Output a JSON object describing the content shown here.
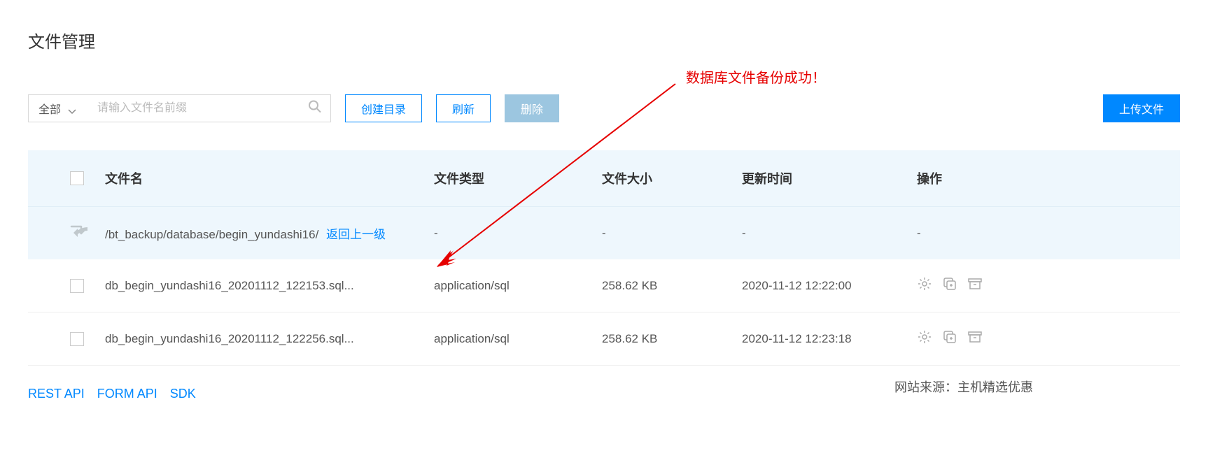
{
  "page_title": "文件管理",
  "annotation": "数据库文件备份成功！",
  "toolbar": {
    "filter_label": "全部",
    "search_placeholder": "请输入文件名前缀",
    "create_dir": "创建目录",
    "refresh": "刷新",
    "delete": "删除",
    "upload": "上传文件"
  },
  "headers": {
    "name": "文件名",
    "type": "文件类型",
    "size": "文件大小",
    "time": "更新时间",
    "ops": "操作"
  },
  "breadcrumb": {
    "path": "/bt_backup/database/begin_yundashi16/",
    "back_label": "返回上一级",
    "dash": "-"
  },
  "rows": [
    {
      "name": "db_begin_yundashi16_20201112_122153.sql...",
      "type": "application/sql",
      "size": "258.62 KB",
      "time": "2020-11-12 12:22:00"
    },
    {
      "name": "db_begin_yundashi16_20201112_122256.sql...",
      "type": "application/sql",
      "size": "258.62 KB",
      "time": "2020-11-12 12:23:18"
    }
  ],
  "footer": {
    "rest_api": "REST API",
    "form_api": "FORM API",
    "sdk": "SDK",
    "source_label": "网站来源：",
    "source_value": "主机精选优惠"
  }
}
